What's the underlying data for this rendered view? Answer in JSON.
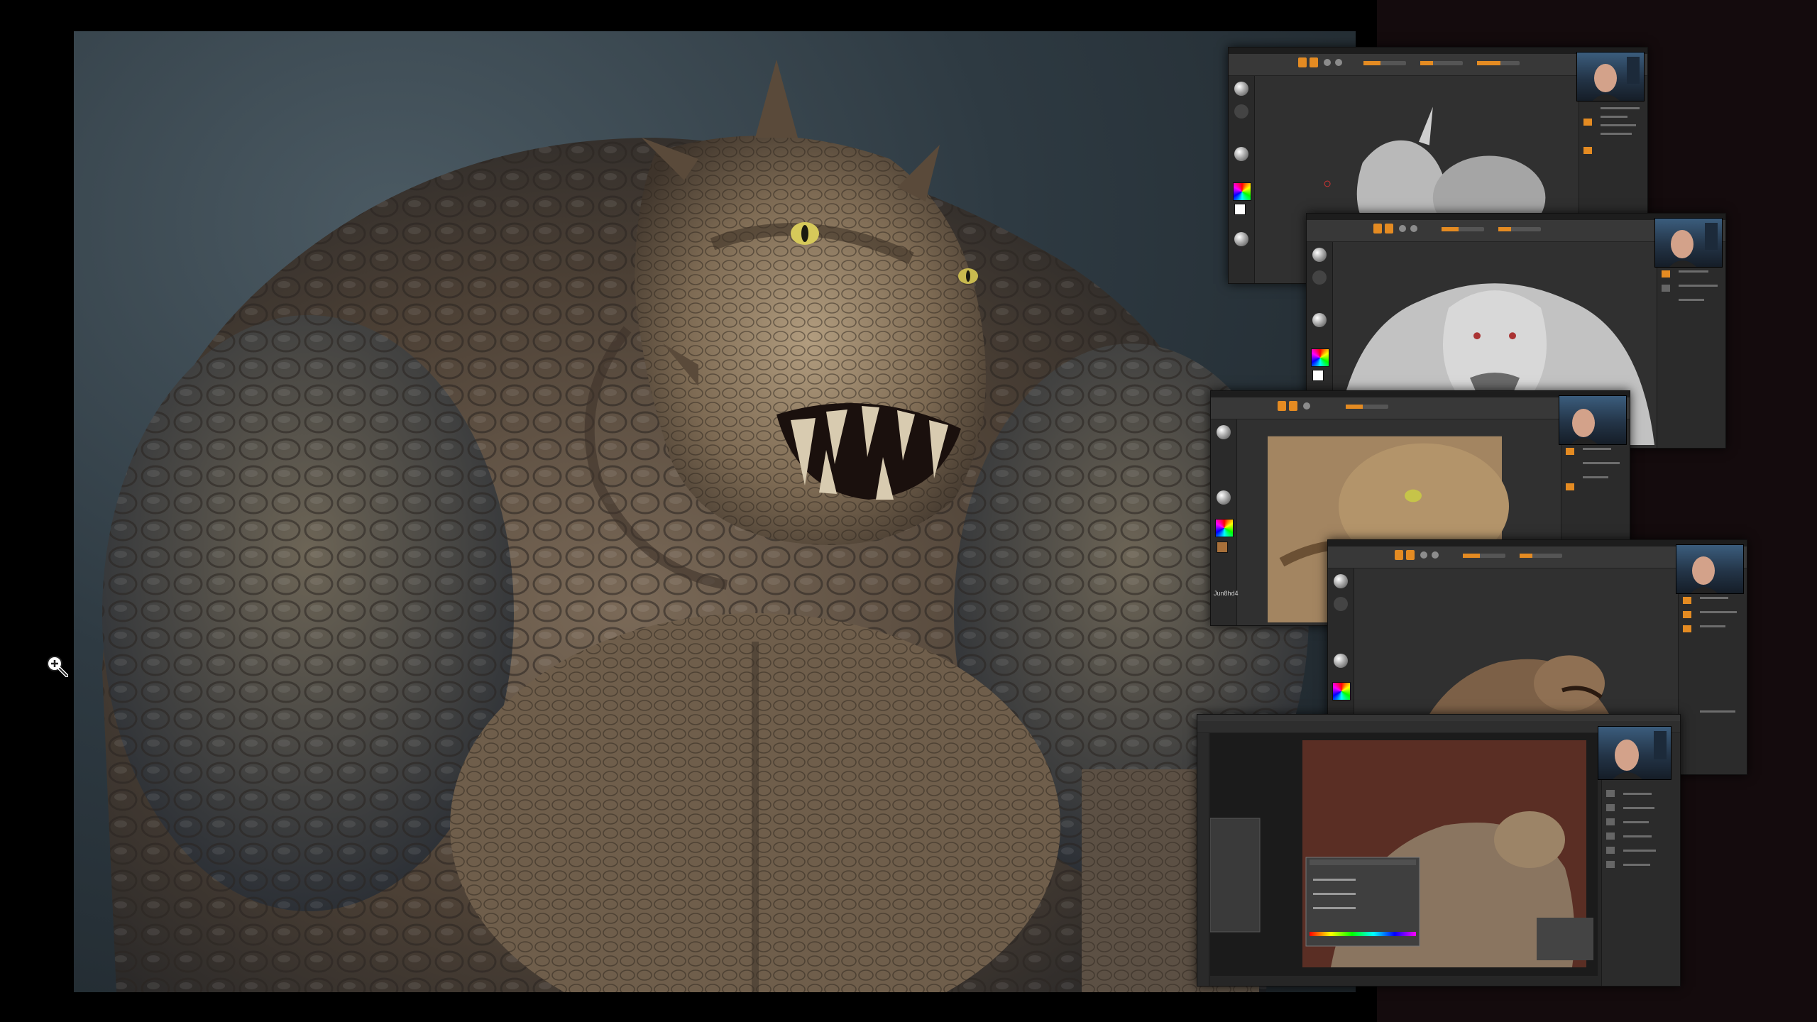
{
  "viewer": {
    "zoom_icon": "zoom-in-icon",
    "backdrop_color": "#140b0d",
    "page_background": "#000000"
  },
  "gallery": {
    "main_image": "creature-final-render",
    "thumbnails": [
      {
        "app": "zbrush",
        "stage": "base-sculpt"
      },
      {
        "app": "zbrush",
        "stage": "front-detail-sculpt"
      },
      {
        "app": "zbrush",
        "stage": "polypaint-closeup"
      },
      {
        "app": "zbrush",
        "stage": "textured-render"
      },
      {
        "app": "photoshop",
        "stage": "compositing"
      }
    ]
  },
  "thumbnail_text": {
    "polypaint_brush_label": "Jun8hd4"
  },
  "accent_color": "#e48b22"
}
